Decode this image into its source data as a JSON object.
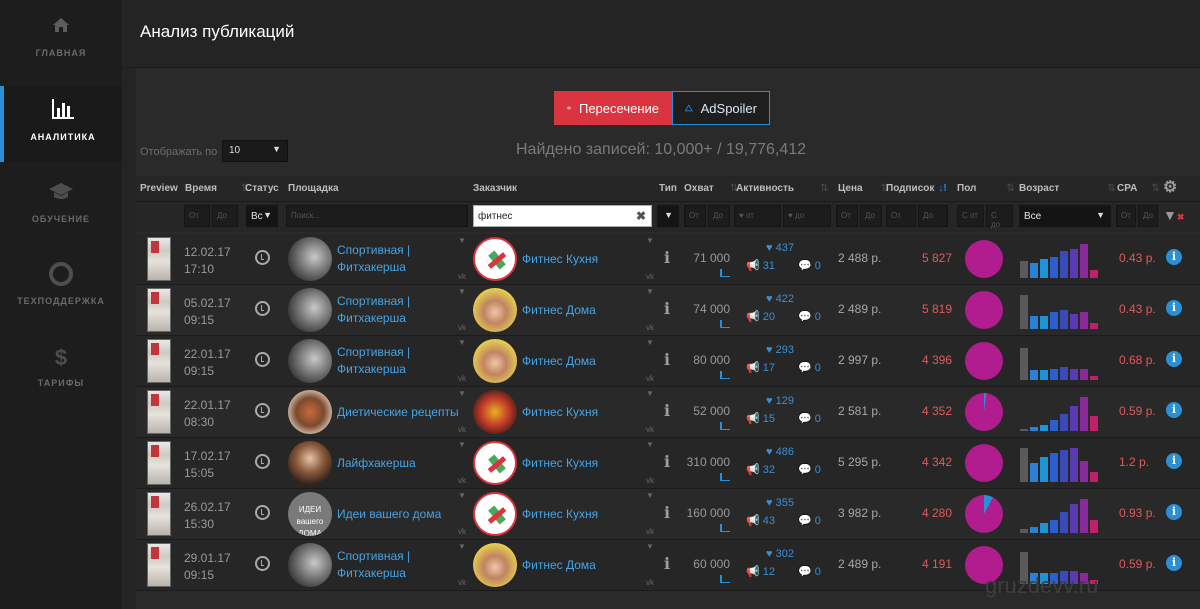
{
  "sidebar": {
    "items": [
      {
        "label": "ГЛАВНАЯ",
        "icon": "home-icon",
        "active": false
      },
      {
        "label": "АНАЛИТИКА",
        "icon": "analytics-icon",
        "active": true
      },
      {
        "label": "ОБУЧЕНИЕ",
        "icon": "graduation-cap-icon",
        "active": false
      },
      {
        "label": "ТЕХПОДДЕРЖКА",
        "icon": "lifebuoy-icon",
        "active": false
      },
      {
        "label": "ТАРИФЫ",
        "icon": "dollar-icon",
        "active": false
      }
    ]
  },
  "header": {
    "title": "Анализ публикаций"
  },
  "toggle": {
    "peresech": "Пересечение",
    "adspoiler": "AdSpoiler"
  },
  "controls": {
    "show_label": "Отображать по",
    "show_value": "10",
    "found": "Найдено записей: 10,000+ / 19,776,412"
  },
  "columns": {
    "preview": "Preview",
    "time": "Время",
    "status": "Статус",
    "platform": "Площадка",
    "customer": "Заказчик",
    "type": "Тип",
    "reach": "Охват",
    "activity": "Активность",
    "price": "Цена",
    "subs": "Подписок",
    "gender": "Пол",
    "age": "Возраст",
    "cpa": "CPA"
  },
  "filters": {
    "time_from": "От",
    "time_to": "До",
    "status_value": "Вс",
    "platform_placeholder": "Поиск...",
    "customer_value": "фитнес",
    "reach_from": "От",
    "reach_to": "До",
    "act_from": "♥ от",
    "act_to": "♥ до",
    "price_from": "От",
    "price_to": "До",
    "subs_from": "От",
    "subs_to": "До",
    "gender_from": "С от",
    "gender_to": "С до",
    "age_value": "Все",
    "cpa_from": "От",
    "cpa_to": "До"
  },
  "rows": [
    {
      "date": "12.02.17",
      "time": "17:10",
      "platform": [
        "Спортивная |",
        "Фитхакерша"
      ],
      "platform_avatar": "grey",
      "customer": "Фитнес Кухня",
      "customer_avatar": "kitchen",
      "reach": "71 000",
      "likes": "437",
      "reposts": "31",
      "comments": "0",
      "price": "2 488 р.",
      "subs": "5 827",
      "cpa": "0.43 р."
    },
    {
      "date": "05.02.17",
      "time": "09:15",
      "platform": [
        "Спортивная |",
        "Фитхакерша"
      ],
      "platform_avatar": "grey",
      "customer": "Фитнес Дома",
      "customer_avatar": "home",
      "reach": "74 000",
      "likes": "422",
      "reposts": "20",
      "comments": "0",
      "price": "2 489 р.",
      "subs": "5 819",
      "cpa": "0.43 р."
    },
    {
      "date": "22.01.17",
      "time": "09:15",
      "platform": [
        "Спортивная |",
        "Фитхакерша"
      ],
      "platform_avatar": "grey",
      "customer": "Фитнес Дома",
      "customer_avatar": "home",
      "reach": "80 000",
      "likes": "293",
      "reposts": "17",
      "comments": "0",
      "price": "2 997 р.",
      "subs": "4 396",
      "cpa": "0.68 р."
    },
    {
      "date": "22.01.17",
      "time": "08:30",
      "platform": [
        "Диетические рецепты"
      ],
      "platform_avatar": "food",
      "customer": "Фитнес Кухня",
      "customer_avatar": "fruit",
      "reach": "52 000",
      "likes": "129",
      "reposts": "15",
      "comments": "0",
      "price": "2 581 р.",
      "subs": "4 352",
      "cpa": "0.59 р."
    },
    {
      "date": "17.02.17",
      "time": "15:05",
      "platform": [
        "Лайфхакерша"
      ],
      "platform_avatar": "girl",
      "customer": "Фитнес Кухня",
      "customer_avatar": "kitchen",
      "reach": "310 000",
      "likes": "486",
      "reposts": "32",
      "comments": "0",
      "price": "5 295 р.",
      "subs": "4 342",
      "cpa": "1.2 р."
    },
    {
      "date": "26.02.17",
      "time": "15:30",
      "platform": [
        "Идеи вашего дома"
      ],
      "platform_avatar": "ideas",
      "customer": "Фитнес Кухня",
      "customer_avatar": "kitchen",
      "reach": "160 000",
      "likes": "355",
      "reposts": "43",
      "comments": "0",
      "price": "3 982 р.",
      "subs": "4 280",
      "cpa": "0.93 р."
    },
    {
      "date": "29.01.17",
      "time": "09:15",
      "platform": [
        "Спортивная |",
        "Фитхакерша"
      ],
      "platform_avatar": "grey",
      "customer": "Фитнес Дома",
      "customer_avatar": "home",
      "reach": "60 000",
      "likes": "302",
      "reposts": "12",
      "comments": "0",
      "price": "2 489 р.",
      "subs": "4 191",
      "cpa": "0.59 р."
    }
  ],
  "ideas_avatar_text": [
    "ИДЕИ",
    "вашего",
    "ДОМА"
  ],
  "watermark": "gruzdevv.ru",
  "colors": {
    "accent": "#2b8fd6",
    "red": "#d9343f",
    "pie": "#b11c8f",
    "subs": "#e05a5a"
  }
}
